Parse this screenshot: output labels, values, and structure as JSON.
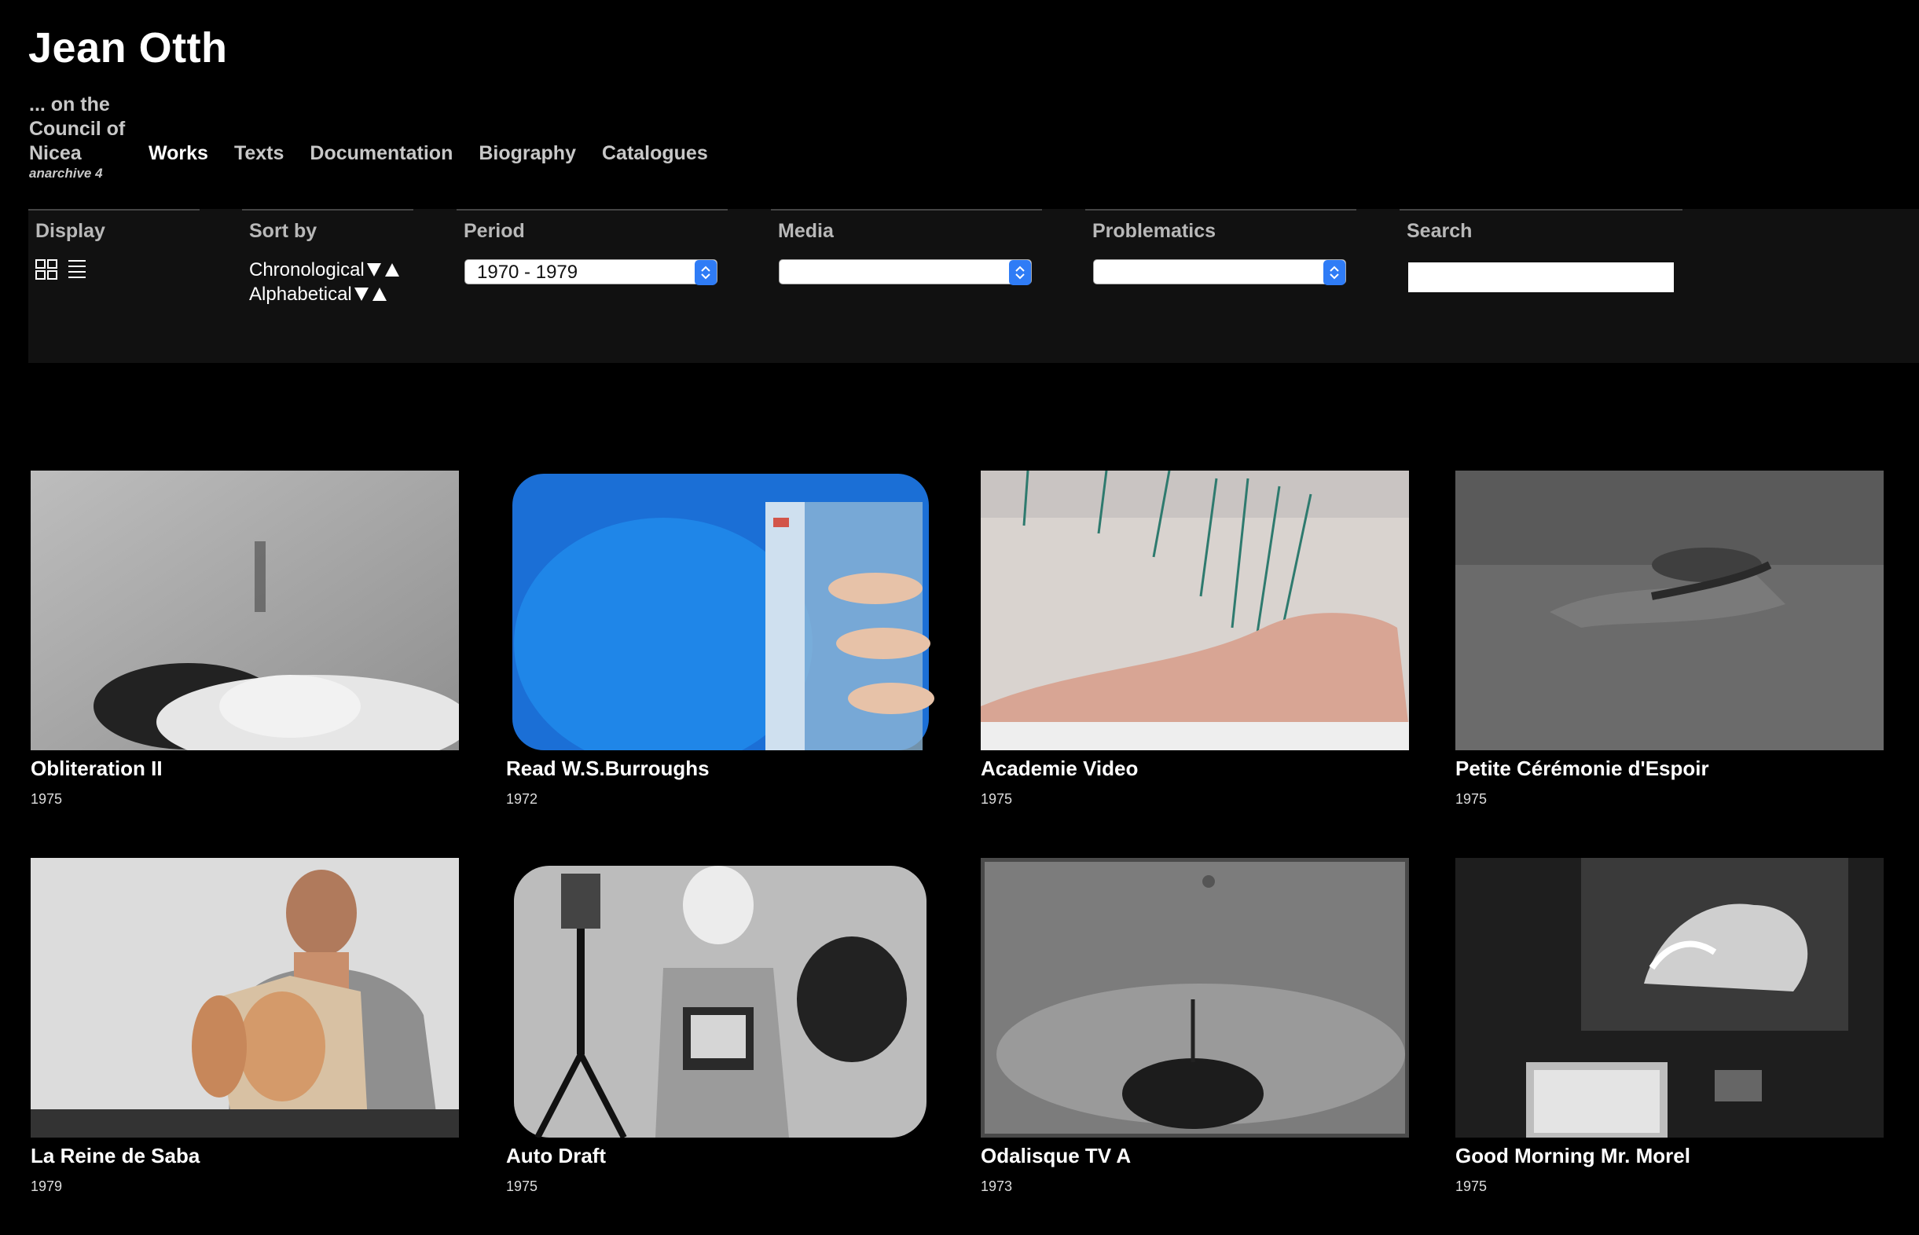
{
  "site": {
    "title": "Jean Otth",
    "archive_title": "... on the Council of Nicea",
    "archive_subtitle": "anarchive 4"
  },
  "nav": {
    "items": [
      {
        "label": "Works",
        "active": true
      },
      {
        "label": "Texts"
      },
      {
        "label": "Documentation"
      },
      {
        "label": "Biography"
      },
      {
        "label": "Catalogues"
      }
    ]
  },
  "filters": {
    "display_label": "Display",
    "sort_label": "Sort by",
    "sort_options": [
      "Chronological",
      "Alphabetical"
    ],
    "period_label": "Period",
    "period_value": "1970 - 1979",
    "media_label": "Media",
    "media_value": "",
    "problematics_label": "Problematics",
    "problematics_value": "",
    "search_label": "Search",
    "search_value": ""
  },
  "icons": {
    "grid_view": "grid-icon",
    "list_view": "list-icon",
    "sort_desc": "triangle-down-icon",
    "sort_asc": "triangle-up-icon",
    "select_arrow": "chevron-updown-icon",
    "accent": "#2f7cf6"
  },
  "works": [
    {
      "title": "Obliteration II",
      "year": "1975"
    },
    {
      "title": "Read W.S.Burroughs",
      "year": "1972"
    },
    {
      "title": "Academie Video",
      "year": "1975"
    },
    {
      "title": "Petite Cérémonie d'Espoir",
      "year": "1975"
    },
    {
      "title": "La Reine de Saba",
      "year": "1979"
    },
    {
      "title": "Auto Draft",
      "year": "1975"
    },
    {
      "title": "Odalisque TV A",
      "year": "1973"
    },
    {
      "title": "Good Morning Mr. Morel",
      "year": "1975"
    }
  ]
}
